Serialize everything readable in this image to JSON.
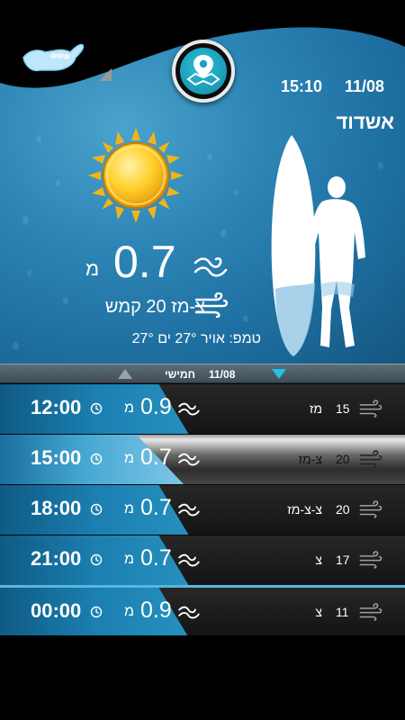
{
  "header": {
    "time": "15:10",
    "date": "11/08",
    "city": "אשדוד"
  },
  "icons": {
    "logo": "shaka-hand-icon",
    "map": "map-pin-icon",
    "weather": "sun-icon",
    "wave": "wave-icon",
    "wind": "wind-icon",
    "clock": "clock-icon",
    "surfer": "surfer-silhouette"
  },
  "current": {
    "wave_height": "0.7",
    "wave_unit": "מ",
    "wind": "צ-מז 20 קמש",
    "temp": "טמפ: אויר 27° ים 27°"
  },
  "day_bar": {
    "day": "חמישי",
    "date": "11/08"
  },
  "forecast": [
    {
      "time": "12:00",
      "wave": "0.9",
      "unit": "מ",
      "wind_speed": "15",
      "wind_dir": "מז"
    },
    {
      "time": "15:00",
      "wave": "0.7",
      "unit": "מ",
      "wind_speed": "20",
      "wind_dir": "צ-מז"
    },
    {
      "time": "18:00",
      "wave": "0.7",
      "unit": "מ",
      "wind_speed": "20",
      "wind_dir": "צ-צ-מז"
    },
    {
      "time": "21:00",
      "wave": "0.7",
      "unit": "מ",
      "wind_speed": "17",
      "wind_dir": "צ"
    },
    {
      "time": "00:00",
      "wave": "0.9",
      "unit": "מ",
      "wind_speed": "11",
      "wind_dir": "צ"
    }
  ],
  "colors": {
    "accent": "#22c2e2",
    "sky": "#2d86b6",
    "row_dark": "#1b1b1b"
  }
}
